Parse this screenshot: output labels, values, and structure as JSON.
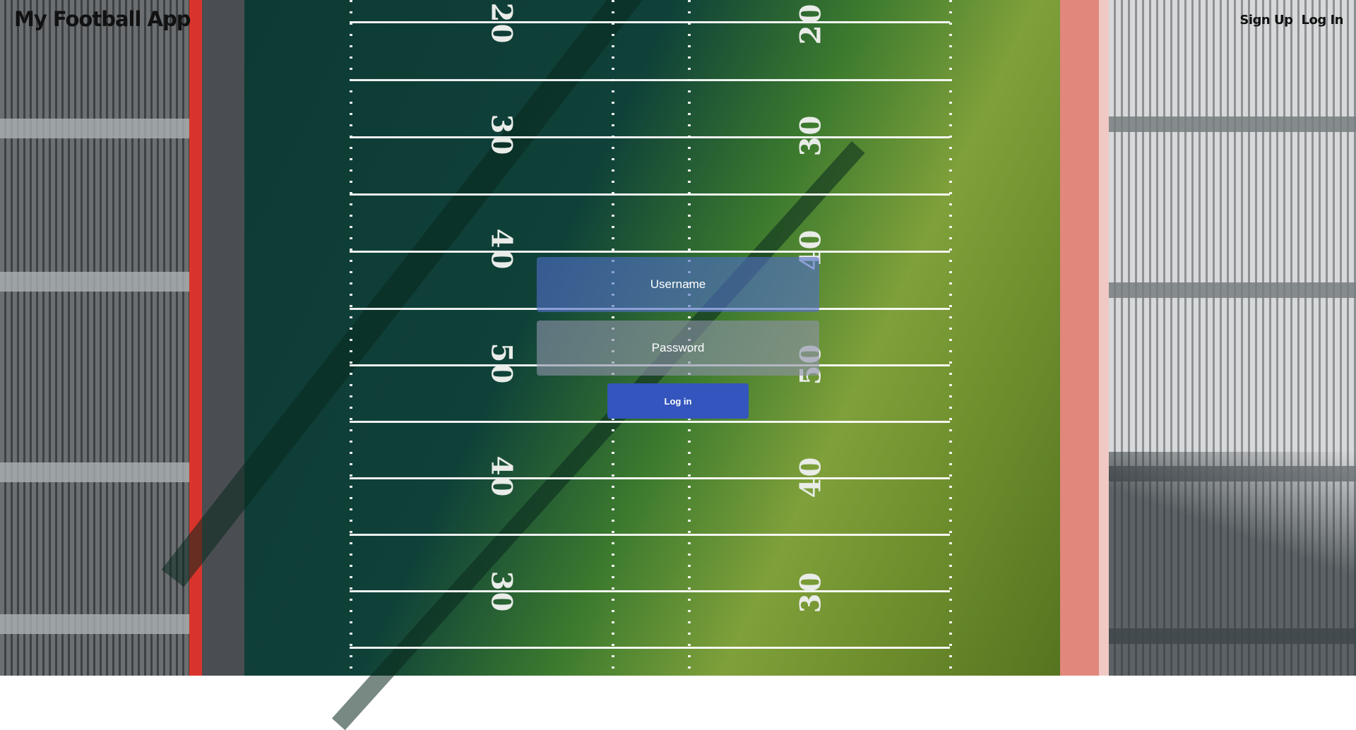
{
  "header": {
    "app_title": "My Football App",
    "nav": {
      "sign_up": "Sign Up",
      "log_in": "Log In"
    }
  },
  "field_markings": {
    "left_numbers": [
      "20",
      "30",
      "40",
      "50",
      "40",
      "30"
    ],
    "right_numbers": [
      "20",
      "30",
      "40",
      "50",
      "40",
      "30"
    ]
  },
  "login_form": {
    "username_placeholder": "Username",
    "password_placeholder": "Password",
    "submit_label": "Log in"
  },
  "colors": {
    "login_button": "#3355bd",
    "field_green": "#0f4139"
  }
}
